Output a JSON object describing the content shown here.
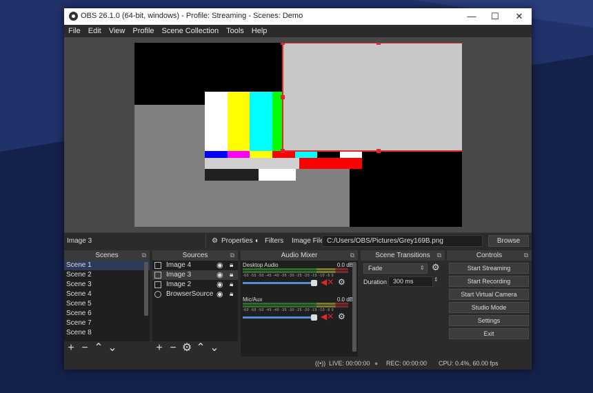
{
  "window": {
    "title": "OBS 26.1.0 (64-bit, windows) - Profile: Streaming - Scenes: Demo"
  },
  "window_controls": {
    "minimize": "—",
    "maximize": "☐",
    "close": "✕"
  },
  "menu": [
    "File",
    "Edit",
    "View",
    "Profile",
    "Scene Collection",
    "Tools",
    "Help"
  ],
  "source_toolbar": {
    "selected_source": "Image 3",
    "properties_label": "Properties",
    "filters_label": "Filters",
    "image_file_label": "Image File",
    "image_file_path": "C:/Users/OBS/Pictures/Grey169B.png",
    "browse_label": "Browse"
  },
  "scenes": {
    "title": "Scenes",
    "items": [
      "Scene 1",
      "Scene 2",
      "Scene 3",
      "Scene 4",
      "Scene 5",
      "Scene 6",
      "Scene 7",
      "Scene 8"
    ],
    "selected_index": 0
  },
  "sources": {
    "title": "Sources",
    "items": [
      "Image 4",
      "Image 3",
      "Image 2",
      "BrowserSource"
    ],
    "selected_index": 1
  },
  "audio_mixer": {
    "title": "Audio Mixer",
    "channels": [
      {
        "name": "Desktop Audio",
        "db": "0.0 dB",
        "volume": 0.72
      },
      {
        "name": "Mic/Aux",
        "db": "0.0 dB",
        "volume": 0.72
      }
    ],
    "tick_labels": "-60 -55 -50 -45 -40 -35 -30 -25 -20 -15 -10 -5 0"
  },
  "scene_transitions": {
    "title": "Scene Transitions",
    "transition": "Fade",
    "duration_label": "Duration",
    "duration_value": "300 ms"
  },
  "controls": {
    "title": "Controls",
    "buttons": [
      "Start Streaming",
      "Start Recording",
      "Start Virtual Camera",
      "Studio Mode",
      "Settings",
      "Exit"
    ]
  },
  "status": {
    "live": "LIVE: 00:00:00",
    "rec": "REC: 00:00:00",
    "cpu": "CPU: 0.4%, 60.00 fps"
  },
  "colors": {
    "accent_selection": "#2d3a58",
    "selection_box": "#e0272c"
  }
}
